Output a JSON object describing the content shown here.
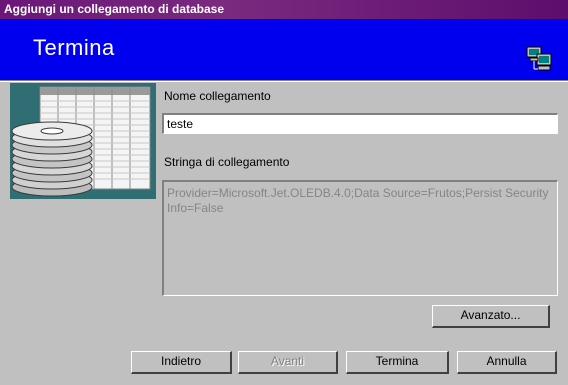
{
  "window": {
    "title": "Aggiungi un collegamento di database"
  },
  "banner": {
    "title": "Termina",
    "icon": "network-computers-icon"
  },
  "art": {
    "icon": "database-disks-table-icon"
  },
  "form": {
    "name_label": "Nome collegamento",
    "name_value": "teste",
    "string_label": "Stringa di collegamento",
    "string_value": "Provider=Microsoft.Jet.OLEDB.4.0;Data Source=Frutos;Persist Security Info=False"
  },
  "buttons": {
    "advanced": "Avanzato...",
    "back": "Indietro",
    "next": "Avanti",
    "finish": "Termina",
    "cancel": "Annulla"
  },
  "colors": {
    "banner": "#0000ee",
    "titlebar": "#6a1778",
    "face": "#c0c0c0",
    "art_bg": "#2f6f73"
  }
}
